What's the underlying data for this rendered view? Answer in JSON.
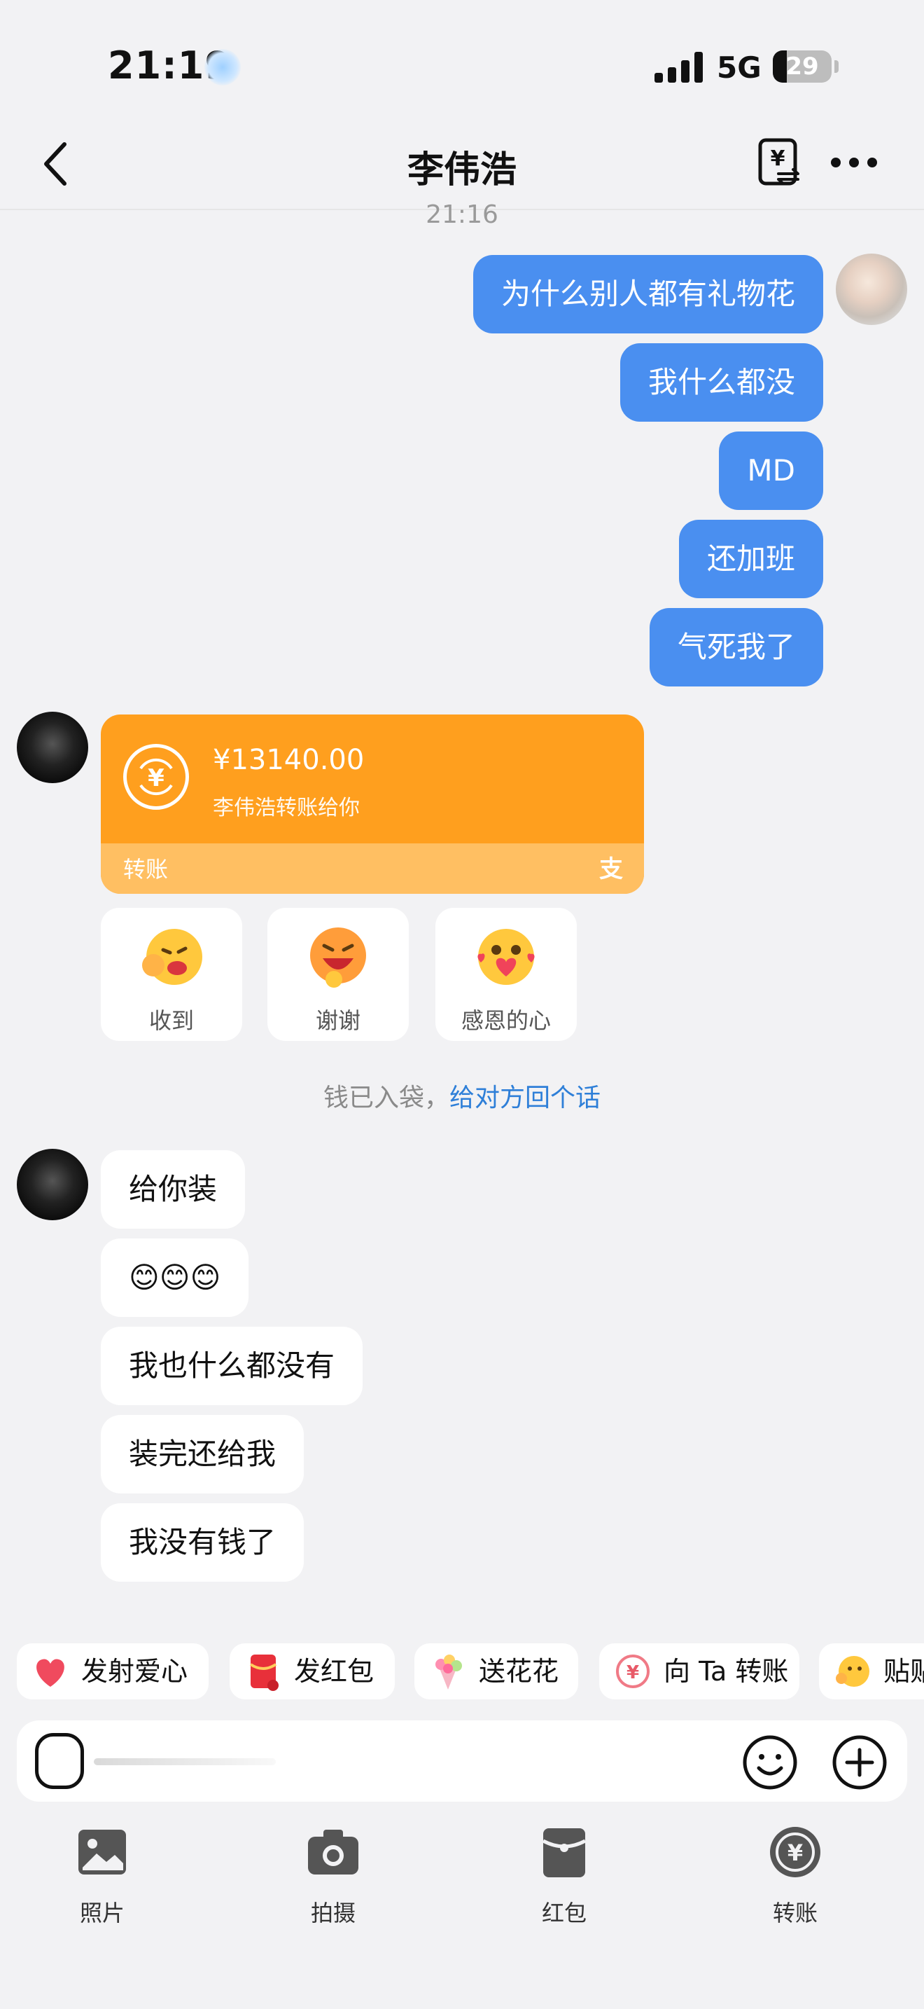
{
  "status": {
    "time": "21:19",
    "network": "5G",
    "battery": "29"
  },
  "nav": {
    "title": "李伟浩"
  },
  "timestamp": "21:16",
  "sent_messages": [
    "为什么别人都有礼物花",
    "我什么都没",
    "MD",
    "还加班",
    "气死我了"
  ],
  "transfer_card": {
    "amount": "¥13140.00",
    "subtitle": "李伟浩转账给你",
    "label": "转账",
    "pay_mark": "支"
  },
  "reactions": [
    "收到",
    "谢谢",
    "感恩的心"
  ],
  "system_note": {
    "text": "钱已入袋，",
    "link": "给对方回个话"
  },
  "received_messages": [
    "给你装",
    "😊😊😊",
    "我也什么都没有",
    "装完还给我",
    "我没有钱了"
  ],
  "quick_actions": [
    "发射爱心",
    "发红包",
    "送花花",
    "向 Ta 转账",
    "贴贴"
  ],
  "input": {
    "value": ""
  },
  "toolbar": [
    "照片",
    "拍摄",
    "红包",
    "转账"
  ],
  "colors": {
    "sent_bubble": "#4a8ff0",
    "transfer_card": "#ff9f1e",
    "link": "#2e7fd8"
  }
}
